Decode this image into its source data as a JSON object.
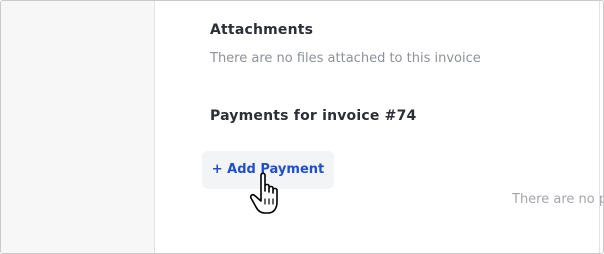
{
  "attachments": {
    "title": "Attachments",
    "empty_message": "There are no files attached to this invoice"
  },
  "payments": {
    "title": "Payments for invoice #74",
    "add_button_label": "+ Add Payment",
    "empty_message": "There are no p"
  },
  "colors": {
    "accent": "#1f4fcf",
    "muted_text": "#8e9199",
    "heading_text": "#2c2f36",
    "button_bg": "#f3f4f6"
  },
  "cursor": {
    "icon": "hand-pointer-icon"
  }
}
